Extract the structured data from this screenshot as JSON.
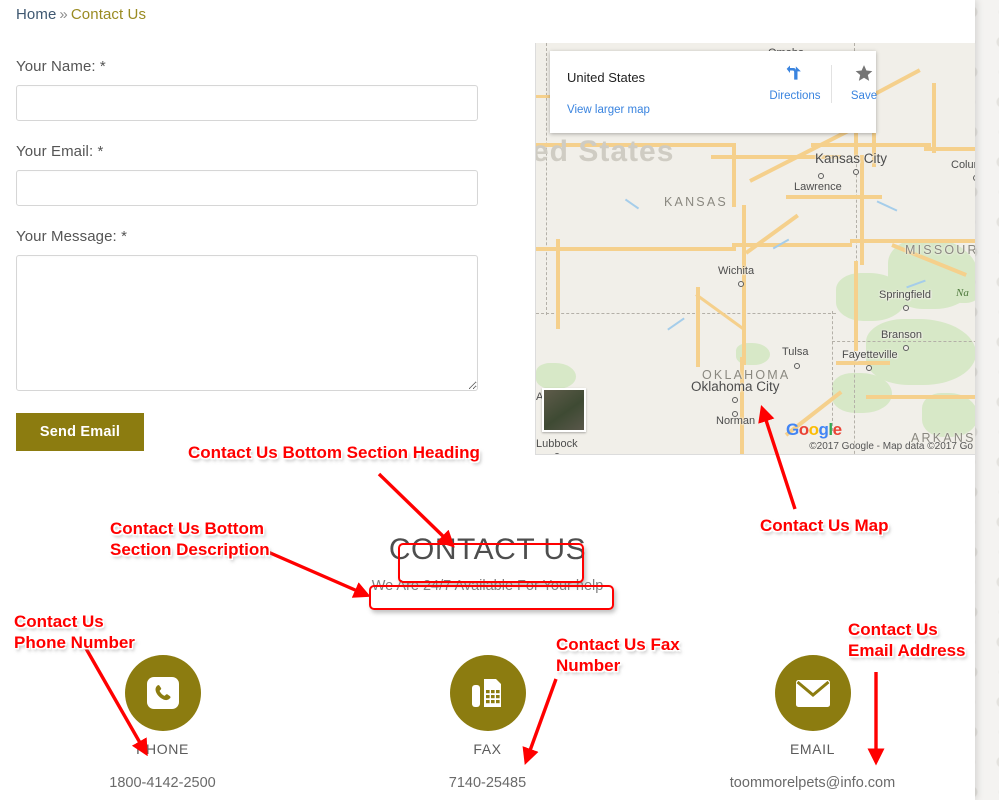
{
  "breadcrumb": {
    "home": "Home",
    "separator": "»",
    "current": "Contact Us"
  },
  "form": {
    "name_label": "Your Name: *",
    "name_value": "",
    "email_label": "Your Email: *",
    "email_value": "",
    "message_label": "Your Message: *",
    "message_value": "",
    "submit_label": "Send Email"
  },
  "map": {
    "card": {
      "title": "United States",
      "directions_label": "Directions",
      "save_label": "Save",
      "view_larger_label": "View larger map"
    },
    "attribution": "©2017 Google - Map data ©2017 Go",
    "logo": "Google",
    "background_state": "ed States",
    "cities": [
      {
        "name": "Omaha"
      },
      {
        "name": "Kansas City"
      },
      {
        "name": "Lawrence"
      },
      {
        "name": "Columbia"
      },
      {
        "name": "Wichita"
      },
      {
        "name": "Springfield"
      },
      {
        "name": "Branson"
      },
      {
        "name": "Tulsa"
      },
      {
        "name": "Fayetteville"
      },
      {
        "name": "Oklahoma City"
      },
      {
        "name": "Norman"
      },
      {
        "name": "Amarillo"
      },
      {
        "name": "Lubbock"
      }
    ],
    "states": [
      "KANSAS",
      "MISSOURI",
      "OKLAHOMA",
      "ARKANSA"
    ],
    "park_label": "Na"
  },
  "bottom": {
    "heading": "CONTACT US",
    "subheading": "We Are 24/7 Available For Your help",
    "items": [
      {
        "icon": "phone-icon",
        "type": "PHONE",
        "value": "1800-4142-2500"
      },
      {
        "icon": "fax-icon",
        "type": "FAX",
        "value": "7140-25485"
      },
      {
        "icon": "email-icon",
        "type": "EMAIL",
        "value": "toommorelpets@info.com"
      }
    ]
  },
  "annotations": [
    {
      "id": "heading",
      "label": "Contact Us Bottom Section Heading"
    },
    {
      "id": "description",
      "label": "Contact Us Bottom\nSection Description"
    },
    {
      "id": "map",
      "label": "Contact Us Map"
    },
    {
      "id": "phone",
      "label": "Contact Us\nPhone Number"
    },
    {
      "id": "fax",
      "label": "Contact Us Fax\nNumber"
    },
    {
      "id": "email",
      "label": "Contact Us\nEmail Address"
    }
  ],
  "colors": {
    "accent": "#8c7c10",
    "breadcrumb_link": "#3f5871",
    "breadcrumb_current": "#9a8b22",
    "annotation": "#ff0000",
    "map_land": "#f1efe9",
    "map_road": "#f5d08c",
    "map_green": "#d7e8c7"
  }
}
